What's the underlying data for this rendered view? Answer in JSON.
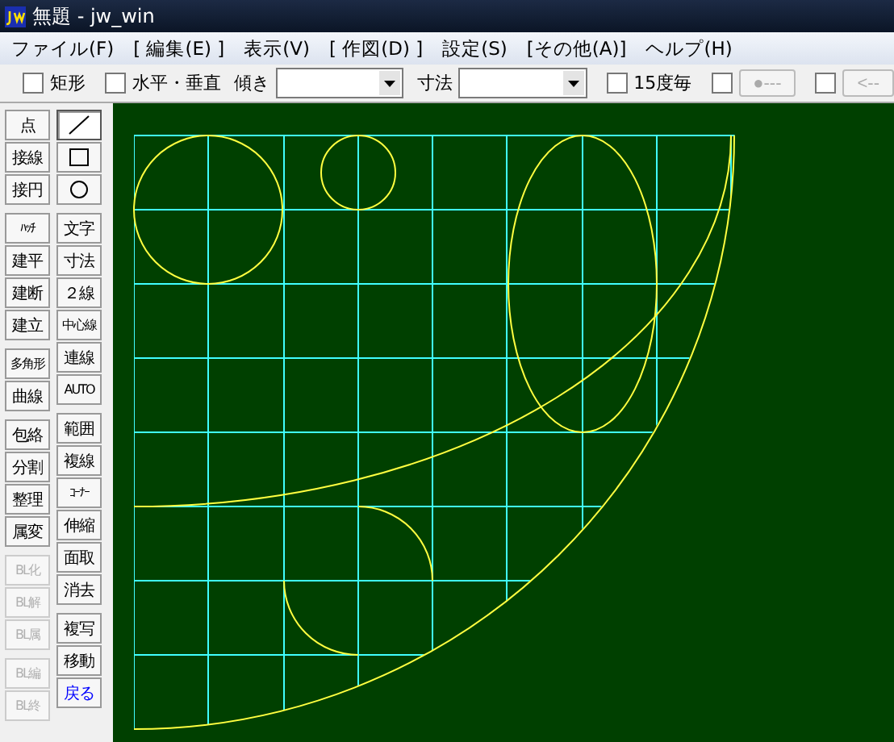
{
  "window": {
    "title": "無題 - jw_win"
  },
  "menu": [
    {
      "label": "ファイル(F)"
    },
    {
      "label": "[ 編集(E) ]"
    },
    {
      "label": "表示(V)"
    },
    {
      "label": "[ 作図(D) ]"
    },
    {
      "label": "設定(S)"
    },
    {
      "label": "[その他(A)]"
    },
    {
      "label": "ヘルプ(H)"
    }
  ],
  "toolbar": [
    {
      "kind": "checkbox",
      "label": "矩形",
      "checked": false
    },
    {
      "kind": "checkbox",
      "label": "水平・垂直",
      "checked": false
    },
    {
      "kind": "combo",
      "label": "傾き"
    },
    {
      "kind": "combo",
      "label": "寸法"
    },
    {
      "kind": "checkbox",
      "label": "15度毎",
      "checked": false
    },
    {
      "kind": "checkbox",
      "checked": false
    },
    {
      "kind": "button",
      "label": "●---",
      "disabled": true
    },
    {
      "kind": "checkbox",
      "checked": false
    },
    {
      "kind": "button",
      "label": "<--",
      "disabled": true
    }
  ],
  "left_toolbar": {
    "column_1": [
      [
        {
          "label": "点",
          "disabled": false
        },
        {
          "label": "接線",
          "disabled": false
        },
        {
          "label": "接円",
          "disabled": false
        }
      ],
      [
        {
          "label": "ﾊｯﾁ",
          "disabled": false
        },
        {
          "label": "建平",
          "disabled": false
        },
        {
          "label": "建断",
          "disabled": false
        },
        {
          "label": "建立",
          "disabled": false
        }
      ],
      [
        {
          "label": "多角形",
          "disabled": false
        },
        {
          "label": "曲線",
          "disabled": false
        }
      ],
      [
        {
          "label": "包絡",
          "disabled": false
        },
        {
          "label": "分割",
          "disabled": false
        },
        {
          "label": "整理",
          "disabled": false
        },
        {
          "label": "属変",
          "disabled": false
        }
      ],
      [
        {
          "label": "BL化",
          "disabled": true
        },
        {
          "label": "BL解",
          "disabled": true
        },
        {
          "label": "BL属",
          "disabled": true
        }
      ],
      [
        {
          "label": "BL編",
          "disabled": true
        },
        {
          "label": "BL終",
          "disabled": true
        }
      ]
    ],
    "column_2": [
      [
        {
          "kind": "line",
          "selected": true
        },
        {
          "kind": "rectangle",
          "selected": false
        },
        {
          "kind": "circle",
          "selected": false
        }
      ],
      [
        {
          "kind": "text",
          "label": "文字",
          "selected": false
        },
        {
          "kind": "text",
          "label": "寸法",
          "selected": false
        },
        {
          "kind": "text",
          "label": "２線",
          "selected": false
        },
        {
          "kind": "text",
          "label": "中心線",
          "selected": false
        },
        {
          "kind": "text",
          "label": "連線",
          "selected": false
        },
        {
          "kind": "text",
          "label": "AUTO",
          "selected": false
        }
      ],
      [
        {
          "kind": "text",
          "label": "範囲",
          "selected": false
        },
        {
          "kind": "text",
          "label": "複線",
          "selected": false
        },
        {
          "kind": "text",
          "label": "ｺｰﾅｰ",
          "selected": false
        },
        {
          "kind": "text",
          "label": "伸縮",
          "selected": false
        },
        {
          "kind": "text",
          "label": "面取",
          "selected": false
        },
        {
          "kind": "text",
          "label": "消去",
          "selected": false
        }
      ],
      [
        {
          "kind": "text",
          "label": "複写",
          "selected": false
        },
        {
          "kind": "text",
          "label": "移動",
          "selected": false
        },
        {
          "kind": "text",
          "label": "戻る",
          "selected": false,
          "color": "#0000ff"
        }
      ]
    ]
  }
}
